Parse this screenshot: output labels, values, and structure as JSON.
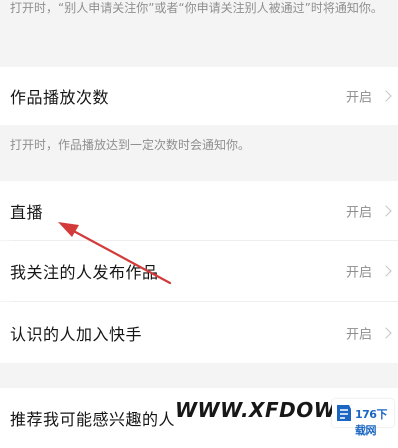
{
  "top_description": "打开时，“别人申请关注你”或者“你申请关注别人被通过”时将通知你。",
  "rows": [
    {
      "label": "作品播放次数",
      "value": "开启",
      "description": "打开时，作品播放达到一定次数时会通知你。"
    },
    {
      "label": "直播",
      "value": "开启"
    },
    {
      "label": "我关注的人发布作品",
      "value": "开启"
    },
    {
      "label": "认识的人加入快手",
      "value": "开启"
    },
    {
      "label": "推荐我可能感兴趣的人"
    }
  ],
  "watermark": {
    "text": "WWW.XFDOW",
    "logo_text": "176下载网"
  },
  "colors": {
    "background": "#f4f4f4",
    "row_bg": "#ffffff",
    "annotation_arrow": "#d33a3a",
    "logo_blue": "#1a66c2"
  },
  "icons": [
    "chevron-right-icon",
    "annotation-arrow",
    "site-logo-icon"
  ]
}
